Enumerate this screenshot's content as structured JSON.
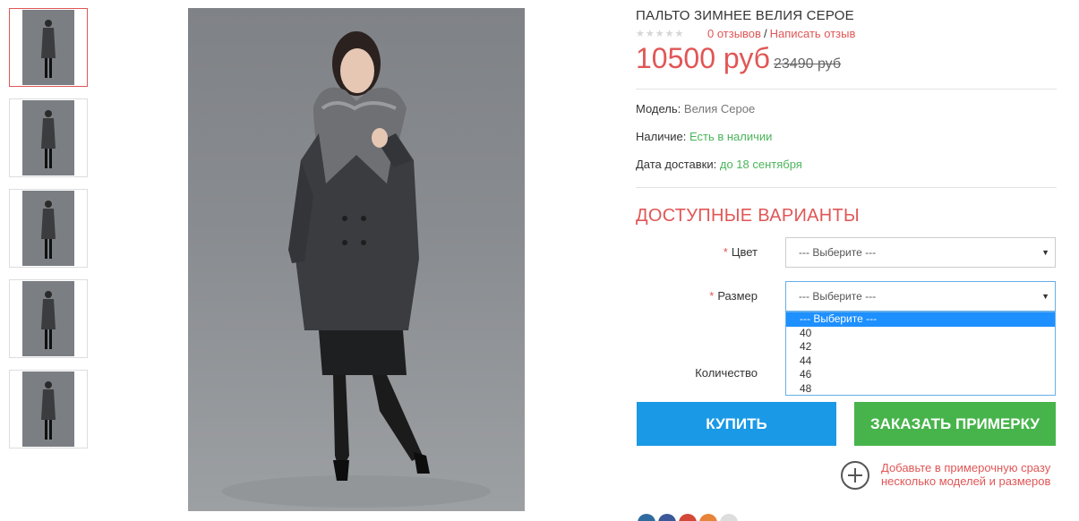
{
  "product": {
    "title": "ПАЛЬТО ЗИМНЕЕ ВЕЛИЯ СЕРОЕ",
    "reviews_link": "0 отзывов",
    "reviews_sep": "/",
    "write_review_link": "Написать отзыв",
    "price": "10500 руб",
    "old_price": "23490 руб",
    "model_label": "Модель:",
    "model_value": "Велия Серое",
    "stock_label": "Наличие:",
    "stock_value": "Есть в наличии",
    "delivery_label": "Дата доставки:",
    "delivery_value": "до 18 сентября"
  },
  "variants": {
    "title": "ДОСТУПНЫЕ ВАРИАНТЫ",
    "required_mark": "*",
    "color_label": "Цвет",
    "color_value": "--- Выберите ---",
    "size_label": "Размер",
    "size_value": "--- Выберите ---",
    "size_options": [
      "--- Выберите ---",
      "40",
      "42",
      "44",
      "46",
      "48"
    ],
    "quantity_label": "Количество"
  },
  "actions": {
    "buy_label": "КУПИТЬ",
    "fitting_label": "ЗАКАЗАТЬ ПРИМЕРКУ",
    "promo_text": "Добавьте в примерочную сразу несколько моделей и размеров"
  },
  "colors": {
    "accent_red": "#e15656",
    "buy_blue": "#1a99e6",
    "fitting_green": "#47b44b",
    "stock_green": "#4bb55b"
  }
}
